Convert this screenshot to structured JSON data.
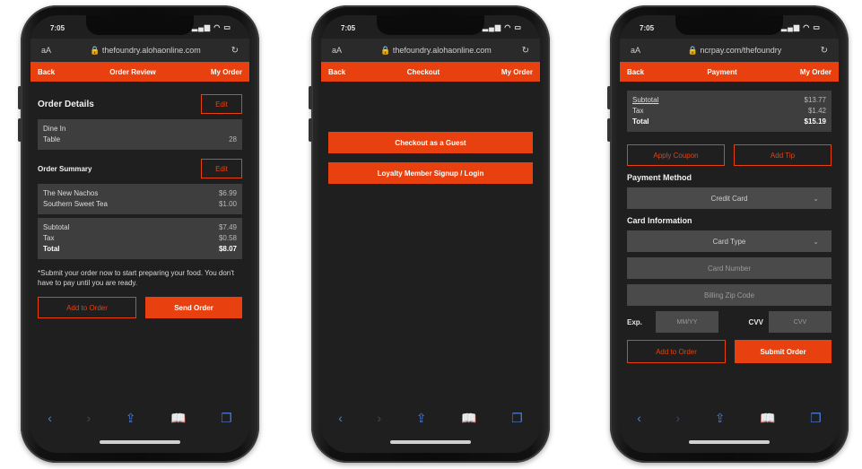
{
  "colors": {
    "accent": "#e8410f",
    "screen_bg": "#1f1f1f",
    "panel": "#3e3e3e",
    "field": "#4a4a4a",
    "safari_icon": "#4a7de0"
  },
  "status": {
    "time": "7:05",
    "icons": "signal-wifi-battery"
  },
  "phones": {
    "review": {
      "url": "thefoundry.alohaonline.com",
      "nav": {
        "back": "Back",
        "title": "Order Review",
        "my_order": "My Order"
      },
      "details": {
        "title": "Order Details",
        "edit": "Edit",
        "dine": "Dine In",
        "table_label": "Table",
        "table_value": "28"
      },
      "summary": {
        "title": "Order Summary",
        "edit": "Edit",
        "items": [
          {
            "name": "The New Nachos",
            "price": "$6.99"
          },
          {
            "name": "Southern Sweet Tea",
            "price": "$1.00"
          }
        ],
        "subtotal": {
          "label": "Subtotal",
          "value": "$7.49"
        },
        "tax": {
          "label": "Tax",
          "value": "$0.58"
        },
        "total": {
          "label": "Total",
          "value": "$8.07"
        }
      },
      "note": "*Submit your order now to start preparing your food. You don't have to pay until you are ready.",
      "add_btn": "Add to Order",
      "send_btn": "Send Order"
    },
    "checkout": {
      "url": "thefoundry.alohaonline.com",
      "nav": {
        "back": "Back",
        "title": "Checkout",
        "my_order": "My Order"
      },
      "guest_btn": "Checkout as a Guest",
      "loyalty_btn": "Loyalty Member Signup / Login"
    },
    "payment": {
      "url": "ncrpay.com/thefoundry",
      "nav": {
        "back": "Back",
        "title": "Payment",
        "my_order": "My Order"
      },
      "subtotal": {
        "label": "Subtotal",
        "value": "$13.77"
      },
      "tax": {
        "label": "Tax",
        "value": "$1.42"
      },
      "total": {
        "label": "Total",
        "value": "$15.19"
      },
      "coupon_btn": "Apply Coupon",
      "tip_btn": "Add Tip",
      "pm_title": "Payment Method",
      "pm_value": "Credit Card",
      "ci_title": "Card Information",
      "card_type": "Card Type",
      "card_number": "Card Number",
      "zip": "Billing Zip Code",
      "exp_label": "Exp.",
      "exp_ph": "MM/YY",
      "cvv_label": "CVV",
      "cvv_ph": "CVV",
      "add_btn": "Add to Order",
      "submit_btn": "Submit Order"
    }
  },
  "toolbar": {
    "back": "‹",
    "forward": "›",
    "share": "⇪",
    "bookmarks": "📖",
    "tabs": "❐"
  }
}
